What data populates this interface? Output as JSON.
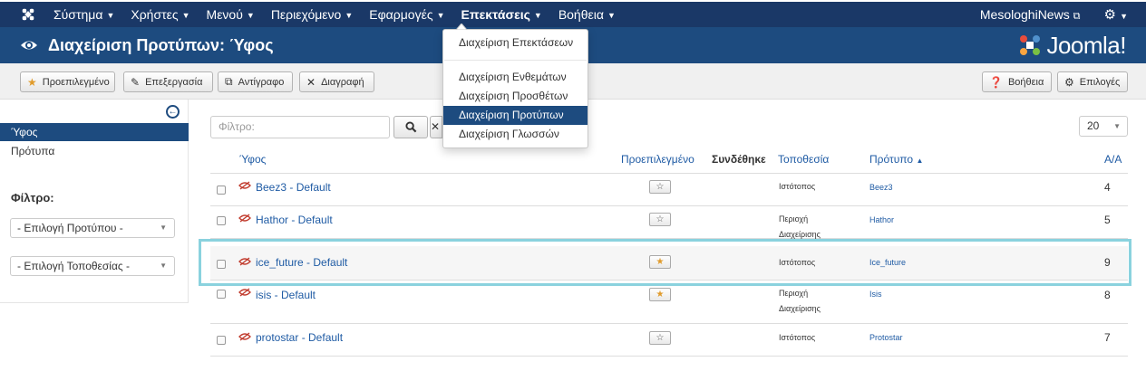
{
  "navbar": {
    "items": [
      {
        "label": "Σύστημα"
      },
      {
        "label": "Χρήστες"
      },
      {
        "label": "Μενού"
      },
      {
        "label": "Περιεχόμενο"
      },
      {
        "label": "Εφαρμογές"
      },
      {
        "label": "Επεκτάσεις"
      },
      {
        "label": "Βοήθεια"
      }
    ],
    "site_link": "MesologhiNews",
    "external_icon": "external-link-icon",
    "settings_icon": "gear-icon"
  },
  "header": {
    "title": "Διαχείριση Προτύπων: Ύφος",
    "brand": "Joomla!"
  },
  "toolbar": {
    "default_label": "Προεπιλεγμένο",
    "edit_label": "Επεξεργασία",
    "copy_label": "Αντίγραφο",
    "delete_label": "Διαγραφή",
    "help_label": "Βοήθεια",
    "options_label": "Επιλογές"
  },
  "sidebar": {
    "active_item": "Ύφος",
    "item": "Πρότυπα",
    "filter_label": "Φίλτρο:",
    "select_template": "- Επιλογή Προτύπου -",
    "select_location": "- Επιλογή Τοποθεσίας -"
  },
  "filter": {
    "search_placeholder": "Φίλτρο:",
    "limit": "20"
  },
  "table": {
    "headers": {
      "style": "Ύφος",
      "default": "Προεπιλεγμένο",
      "assigned": "Συνδέθηκε",
      "location": "Τοποθεσία",
      "template": "Πρότυπο",
      "id": "Α/Α"
    },
    "rows": [
      {
        "name": "Beez3 - Default",
        "location": "Ιστότοπος",
        "template": "Beez3",
        "id": "4",
        "default": false
      },
      {
        "name": "Hathor - Default",
        "location": "Περιοχή Διαχείρισης",
        "template": "Hathor",
        "id": "5",
        "default": false
      },
      {
        "name": "ice_future - Default",
        "location": "Ιστότοπος",
        "template": "Ice_future",
        "id": "9",
        "default": true
      },
      {
        "name": "isis - Default",
        "location": "Περιοχή Διαχείρισης",
        "template": "Isis",
        "id": "8",
        "default": true
      },
      {
        "name": "protostar - Default",
        "location": "Ιστότοπος",
        "template": "Protostar",
        "id": "7",
        "default": false
      }
    ]
  },
  "dropdown": {
    "items": [
      "Διαχείριση Επεκτάσεων",
      "Διαχείριση Ενθεμάτων",
      "Διαχείριση Προσθέτων",
      "Διαχείριση Προτύπων",
      "Διαχείριση Γλωσσών"
    ],
    "active_index": 3
  },
  "colors": {
    "navbar": "#1a3867",
    "header": "#1d4b7f",
    "link": "#1f5ba4",
    "highlight": "#8ad2de",
    "star_default": "#e09b2c"
  }
}
